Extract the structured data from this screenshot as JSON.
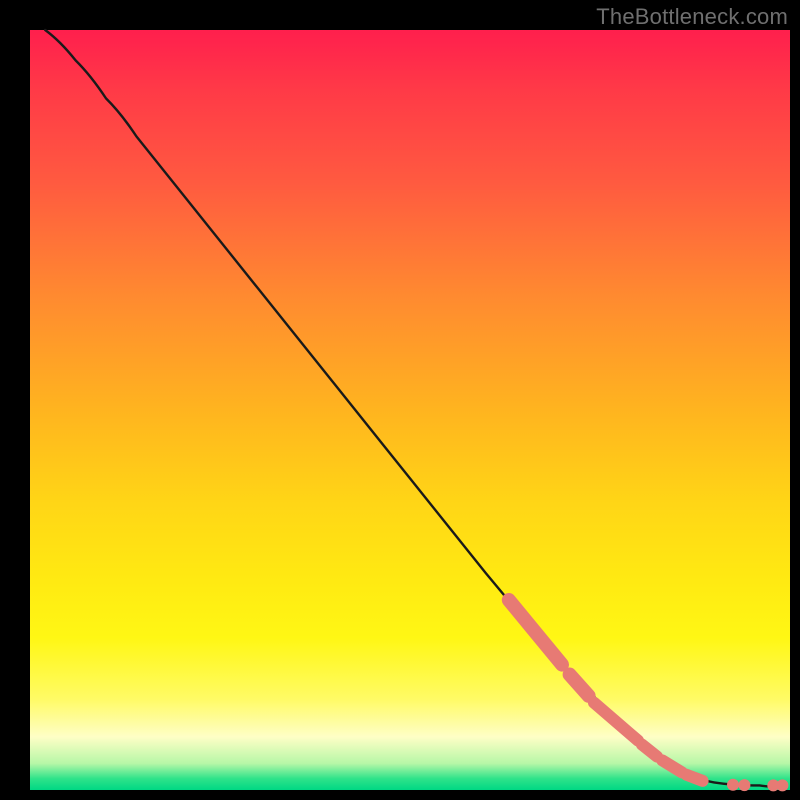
{
  "watermark": "TheBottleneck.com",
  "colors": {
    "marker": "#e77a74",
    "curve": "#1a1a1a",
    "frame": "#000000"
  },
  "chart_data": {
    "type": "line",
    "title": "",
    "xlabel": "",
    "ylabel": "",
    "xlim": [
      0,
      100
    ],
    "ylim": [
      0,
      100
    ],
    "grid": false,
    "curve": [
      {
        "x": 2,
        "y": 100
      },
      {
        "x": 6,
        "y": 96
      },
      {
        "x": 10,
        "y": 91
      },
      {
        "x": 14,
        "y": 86
      },
      {
        "x": 20,
        "y": 78.5
      },
      {
        "x": 30,
        "y": 66
      },
      {
        "x": 40,
        "y": 53.5
      },
      {
        "x": 50,
        "y": 41
      },
      {
        "x": 60,
        "y": 28.5
      },
      {
        "x": 70,
        "y": 16.5
      },
      {
        "x": 80,
        "y": 6.5
      },
      {
        "x": 86,
        "y": 2.2
      },
      {
        "x": 90,
        "y": 1.0
      },
      {
        "x": 96,
        "y": 0.6
      },
      {
        "x": 99,
        "y": 0.6
      }
    ],
    "highlight_segments": [
      {
        "x0": 63,
        "y0": 25.0,
        "x1": 70,
        "y1": 16.5,
        "w": 14
      },
      {
        "x0": 71,
        "y0": 15.2,
        "x1": 73.5,
        "y1": 12.4,
        "w": 14
      },
      {
        "x0": 74.2,
        "y0": 11.5,
        "x1": 80,
        "y1": 6.5,
        "w": 12
      },
      {
        "x0": 80.5,
        "y0": 6.0,
        "x1": 82.5,
        "y1": 4.4,
        "w": 12
      },
      {
        "x0": 83.2,
        "y0": 3.9,
        "x1": 85.8,
        "y1": 2.3,
        "w": 12
      },
      {
        "x0": 86.4,
        "y0": 2.0,
        "x1": 88.5,
        "y1": 1.2,
        "w": 12
      }
    ],
    "highlight_dots": [
      {
        "x": 92.5,
        "y": 0.7,
        "r": 6
      },
      {
        "x": 94.0,
        "y": 0.65,
        "r": 6
      },
      {
        "x": 97.8,
        "y": 0.6,
        "r": 6
      },
      {
        "x": 99.0,
        "y": 0.6,
        "r": 6
      }
    ]
  }
}
